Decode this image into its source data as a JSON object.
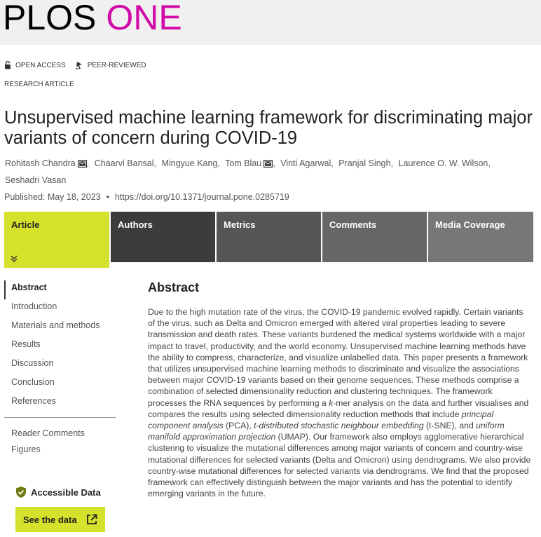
{
  "header": {
    "logo_plos": "PLOS",
    "logo_one": "ONE"
  },
  "badges": {
    "open_access": "OPEN ACCESS",
    "peer_reviewed": "PEER-REVIEWED"
  },
  "article_type": "RESEARCH ARTICLE",
  "title": "Unsupervised machine learning framework for discriminating major variants of concern during COVID-19",
  "authors": [
    {
      "name": "Rohitash Chandra",
      "email": true
    },
    {
      "name": "Chaarvi Bansal",
      "email": false
    },
    {
      "name": "Mingyue Kang",
      "email": false
    },
    {
      "name": "Tom Blau",
      "email": true
    },
    {
      "name": "Vinti Agarwal",
      "email": false
    },
    {
      "name": "Pranjal Singh",
      "email": false
    },
    {
      "name": "Laurence O. W. Wilson",
      "email": false
    },
    {
      "name": "Seshadri Vasan",
      "email": false
    }
  ],
  "published": "Published: May 18, 2023",
  "doi": "https://doi.org/10.1371/journal.pone.0285719",
  "tabs": [
    "Article",
    "Authors",
    "Metrics",
    "Comments",
    "Media Coverage"
  ],
  "nav": {
    "sections": [
      "Abstract",
      "Introduction",
      "Materials and methods",
      "Results",
      "Discussion",
      "Conclusion",
      "References"
    ],
    "extra": [
      "Reader Comments",
      "Figures"
    ]
  },
  "data_box": {
    "accessible_label": "Accessible Data",
    "see_data_label": "See the data"
  },
  "abstract": {
    "heading": "Abstract",
    "p1": "Due to the high mutation rate of the virus, the COVID-19 pandemic evolved rapidly. Certain variants of the virus, such as Delta and Omicron emerged with altered viral properties leading to severe transmission and death rates. These variants burdened the medical systems worldwide with a major impact to travel, productivity, and the world economy. Unsupervised machine learning methods have the ability to compress, characterize, and visualize unlabelled data. This paper presents a framework that utilizes unsupervised machine learning methods to discriminate and visualize the associations between major COVID-19 variants based on their genome sequences. These methods comprise a combination of selected dimensionality reduction and clustering techniques. The framework processes the RNA sequences by performing a ",
    "kmer": "k",
    "p2": "-mer analysis on the data and further visualises and compares the results using selected dimensionality reduction methods that include ",
    "pca": "principal component analysis",
    "p3": " (PCA), ",
    "tsne": "t-distributed stochastic neighbour embedding",
    "p4": " (t-SNE), and ",
    "umap": "uniform manifold approximation projection",
    "p5": " (UMAP). Our framework also employs agglomerative hierarchical clustering to visualize the mutational differences among major variants of concern and country-wise mutational differences for selected variants (Delta and Omicron) using dendrograms. We also provide country-wise mutational differences for selected variants via dendrograms. We find that the proposed framework can effectively distinguish between the major variants and has the potential to identify emerging variants in the future."
  },
  "colors": {
    "brand_magenta": "#d20ba8",
    "accent_lime": "#d5e22b"
  }
}
